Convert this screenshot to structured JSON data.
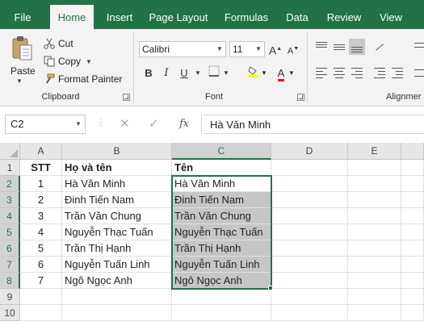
{
  "tabs": [
    {
      "label": "File",
      "active": false
    },
    {
      "label": "Home",
      "active": true
    },
    {
      "label": "Insert",
      "active": false
    },
    {
      "label": "Page Layout",
      "active": false
    },
    {
      "label": "Formulas",
      "active": false
    },
    {
      "label": "Data",
      "active": false
    },
    {
      "label": "Review",
      "active": false
    },
    {
      "label": "View",
      "active": false
    }
  ],
  "ribbon": {
    "clipboard": {
      "paste_label": "Paste",
      "cut_label": "Cut",
      "copy_label": "Copy",
      "format_painter_label": "Format Painter",
      "group_label": "Clipboard"
    },
    "font": {
      "font_name": "Calibri",
      "font_size": "11",
      "grow_label": "A",
      "shrink_label": "A",
      "bold_label": "B",
      "italic_label": "I",
      "underline_label": "U",
      "font_color_label": "A",
      "group_label": "Font",
      "highlight_color": "#ffff00",
      "font_color": "#ff0000"
    },
    "alignment": {
      "group_label": "Alignmer"
    }
  },
  "formula_bar": {
    "name_box": "C2",
    "fx_label": "fx",
    "formula": "Hà Văn Minh"
  },
  "sheet": {
    "columns": [
      "A",
      "B",
      "C",
      "D",
      "E"
    ],
    "row_numbers": [
      "1",
      "2",
      "3",
      "4",
      "5",
      "6",
      "7",
      "8",
      "9",
      "10"
    ],
    "rows": [
      [
        "STT",
        "Họ và tên",
        "Tên"
      ],
      [
        "1",
        "Hà Văn Minh",
        "Hà Văn Minh"
      ],
      [
        "2",
        "Đinh Tiến Nam",
        "Đinh Tiến Nam"
      ],
      [
        "3",
        "Trần Văn Chung",
        "Trần Văn Chung"
      ],
      [
        "4",
        "Nguyễn Thạc Tuấn",
        "Nguyễn Thạc Tuấn"
      ],
      [
        "5",
        "Trần Thị Hạnh",
        "Trần Thị Hạnh"
      ],
      [
        "6",
        "Nguyễn Tuấn Linh",
        "Nguyễn Tuấn Linh"
      ],
      [
        "7",
        "Ngô Ngọc Anh",
        "Ngô Ngọc Anh"
      ]
    ],
    "selected_column": "C",
    "selection": "C2:C8",
    "accent_color": "#217346"
  }
}
